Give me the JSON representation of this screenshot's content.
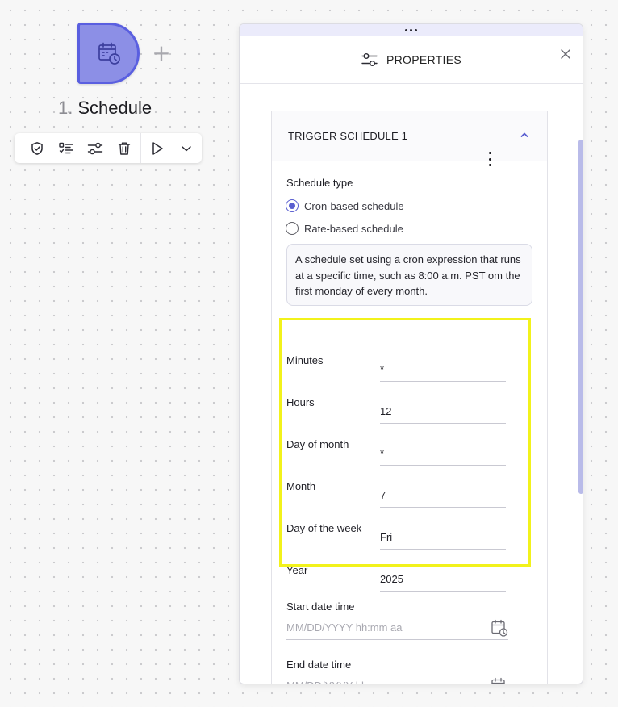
{
  "canvas": {
    "node": {
      "icon": "calendar-clock-icon",
      "step_number": "1.",
      "title": "Schedule",
      "add_symbol": "+",
      "fill_color": "#8c8fe6",
      "border_color": "#5a5fe0"
    },
    "toolbar": {
      "items": [
        "shield-check-icon",
        "checklist-icon",
        "sliders-icon",
        "trash-icon",
        "play-icon",
        "chevron-down-icon"
      ]
    }
  },
  "panel": {
    "title": "PROPERTIES",
    "header_icon": "sliders-icon",
    "close_icon": "close-icon",
    "section": {
      "title": "TRIGGER SCHEDULE 1",
      "chevron_icon": "chevron-up-icon",
      "menu_icon": "kebab-menu-icon",
      "schedule_type_label": "Schedule type",
      "options": [
        {
          "label": "Cron-based schedule",
          "selected": true
        },
        {
          "label": "Rate-based schedule",
          "selected": false
        }
      ],
      "description": "A schedule set using a cron expression that runs at a specific time, such as 8:00 a.m. PST om the first monday of every month.",
      "cron_fields": [
        {
          "label": "Minutes",
          "value": "*"
        },
        {
          "label": "Hours",
          "value": "12"
        },
        {
          "label": "Day of month",
          "value": "*"
        },
        {
          "label": "Month",
          "value": "7"
        },
        {
          "label": "Day of the week",
          "value": "Fri"
        },
        {
          "label": "Year",
          "value": "2025"
        }
      ],
      "start_date": {
        "label": "Start date time",
        "placeholder": "MM/DD/YYYY hh:mm aa",
        "icon": "calendar-clock-icon"
      },
      "end_date": {
        "label": "End date time",
        "placeholder": "MM/DD/YYYY hh:mm aa",
        "icon": "calendar-clock-icon"
      }
    },
    "accent_color": "#5a5fd0",
    "highlight_color": "#f2f21b"
  }
}
